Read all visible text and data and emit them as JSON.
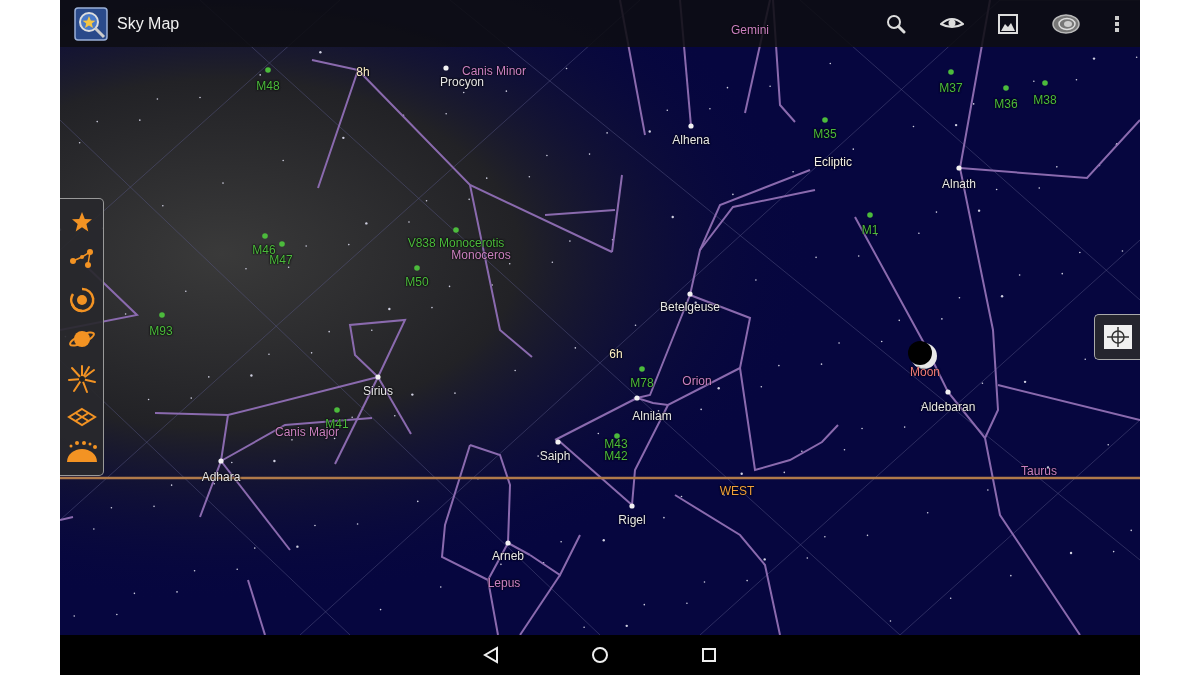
{
  "app_bar": {
    "title": "Sky Map"
  },
  "sky_labels": [
    {
      "text": "Gemini",
      "kind": "constellation"
    },
    {
      "text": "M48",
      "kind": "messier"
    },
    {
      "text": "8h",
      "kind": "grid"
    },
    {
      "text": "Canis Minor",
      "kind": "constellation"
    },
    {
      "text": "Procyon",
      "kind": "star"
    },
    {
      "text": "M37",
      "kind": "messier"
    },
    {
      "text": "M36",
      "kind": "messier"
    },
    {
      "text": "M38",
      "kind": "messier"
    },
    {
      "text": "M35",
      "kind": "messier"
    },
    {
      "text": "Alhena",
      "kind": "star"
    },
    {
      "text": "Ecliptic",
      "kind": "ecliptic"
    },
    {
      "text": "Alnath",
      "kind": "star"
    },
    {
      "text": "M1",
      "kind": "messier"
    },
    {
      "text": "M46",
      "kind": "messier"
    },
    {
      "text": "M47",
      "kind": "messier"
    },
    {
      "text": "V838 Monocerotis",
      "kind": "messier"
    },
    {
      "text": "Monoceros",
      "kind": "constellation"
    },
    {
      "text": "M50",
      "kind": "messier"
    },
    {
      "text": "M93",
      "kind": "messier"
    },
    {
      "text": "Betelgeuse",
      "kind": "star"
    },
    {
      "text": "6h",
      "kind": "grid"
    },
    {
      "text": "Moon",
      "kind": "planet"
    },
    {
      "text": "M78",
      "kind": "messier"
    },
    {
      "text": "Orion",
      "kind": "constellation"
    },
    {
      "text": "Sirius",
      "kind": "star"
    },
    {
      "text": "Aldebaran",
      "kind": "star"
    },
    {
      "text": "Alnilam",
      "kind": "star"
    },
    {
      "text": "M41",
      "kind": "messier"
    },
    {
      "text": "Canis Major",
      "kind": "constellation"
    },
    {
      "text": "M43",
      "kind": "messier"
    },
    {
      "text": "M42",
      "kind": "messier"
    },
    {
      "text": "Saiph",
      "kind": "star"
    },
    {
      "text": "Adhara",
      "kind": "star"
    },
    {
      "text": "Taurus",
      "kind": "constellation"
    },
    {
      "text": "WEST",
      "kind": "horizon"
    },
    {
      "text": "Rigel",
      "kind": "star"
    },
    {
      "text": "Arneb",
      "kind": "star"
    },
    {
      "text": "Lepus",
      "kind": "constellation"
    }
  ]
}
